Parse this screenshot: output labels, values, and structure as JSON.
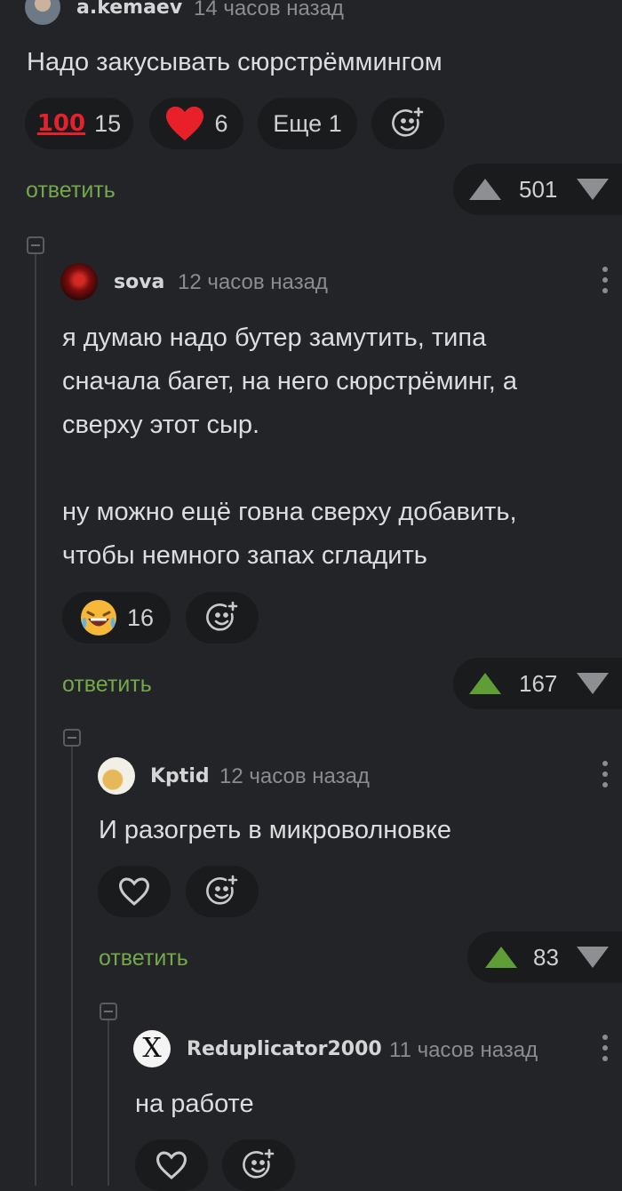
{
  "comments": [
    {
      "author": "a.kemaev",
      "time": "14 часов назад",
      "text_lines": [
        "Надо закусывать сюрстрёммингом"
      ],
      "reactions": [
        {
          "icon": "hundred-points-icon",
          "glyph": "💯",
          "count": "15"
        },
        {
          "icon": "heart-icon",
          "glyph": "❤",
          "count": "6"
        }
      ],
      "more_label": "Еще 1",
      "reply_label": "ответить",
      "rating": "501",
      "vote_state": "none"
    },
    {
      "author": "sova",
      "time": "12 часов назад",
      "text_lines": [
        "я думаю надо бутер замутить, типа",
        "сначала багет, на него сюрстрёминг, а",
        "сверху этот сыр.",
        "",
        "ну можно ещё говна сверху добавить,",
        "чтобы немного запах сгладить"
      ],
      "reactions": [
        {
          "icon": "laughing-face-icon",
          "glyph": "😂",
          "count": "16"
        }
      ],
      "reply_label": "ответить",
      "rating": "167",
      "vote_state": "up"
    },
    {
      "author": "Kptid",
      "time": "12 часов назад",
      "text_lines": [
        "И разогреть в микроволновке"
      ],
      "reply_label": "ответить",
      "rating": "83",
      "vote_state": "up"
    },
    {
      "author": "Reduplicator2000",
      "avatar_letter": "X",
      "time": "11 часов назад",
      "text_lines": [
        "на работе"
      ]
    }
  ],
  "colors": {
    "background": "#232427",
    "accent_green": "#74a94b",
    "upvote_green": "#5f9e36",
    "heart_red": "#e8202a"
  }
}
